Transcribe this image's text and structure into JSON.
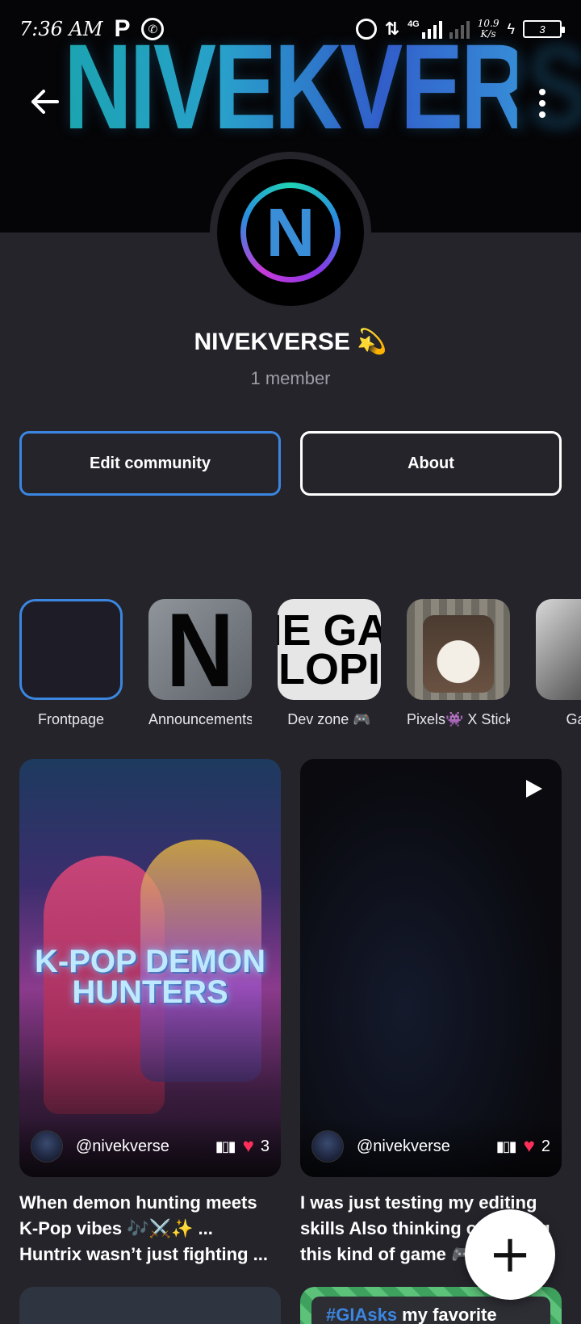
{
  "status_bar": {
    "time": "7:36 AM",
    "network": "4G",
    "speed_value": "10.9",
    "speed_unit": "K/s",
    "battery": "3"
  },
  "header": {
    "banner_title": "NIVEKVERSE",
    "back_icon": "arrow-left-icon",
    "more_icon": "more-vert-icon"
  },
  "community": {
    "avatar_letter": "N",
    "name": "NIVEKVERSE 💫",
    "members": "1 member"
  },
  "actions": {
    "edit_label": "Edit community",
    "about_label": "About"
  },
  "categories": [
    {
      "label": "Frontpage"
    },
    {
      "label": "Announcements"
    },
    {
      "label": "Dev zone 🎮",
      "thumb_text_1": "IE GA",
      "thumb_text_2": "LOPI"
    },
    {
      "label": "Pixels👾 X Stickers"
    },
    {
      "label": "Gacha"
    }
  ],
  "posts": [
    {
      "thumb_text": "K-POP DEMON HUNTERS",
      "author": "@nivekverse",
      "likes": "3",
      "caption_1": "When demon hunting meets",
      "caption_2": "K-Pop vibes 🎶⚔️✨ ...",
      "caption_3": "Huntrix wasn’t just fighting ..."
    },
    {
      "author": "@nivekverse",
      "likes": "2",
      "caption_1": "I was just testing my editing",
      "caption_2": "skills Also thinking of making",
      "caption_3": "this kind of game 🎮 #GIAsks"
    }
  ],
  "peek": {
    "hashtag": "#GIAsks",
    "rest": " my favorite"
  },
  "fab": {
    "symbol": "+"
  },
  "colors": {
    "background": "#25242b",
    "accent_blue": "#3b86e0",
    "heart_red": "#ff2f5a"
  }
}
